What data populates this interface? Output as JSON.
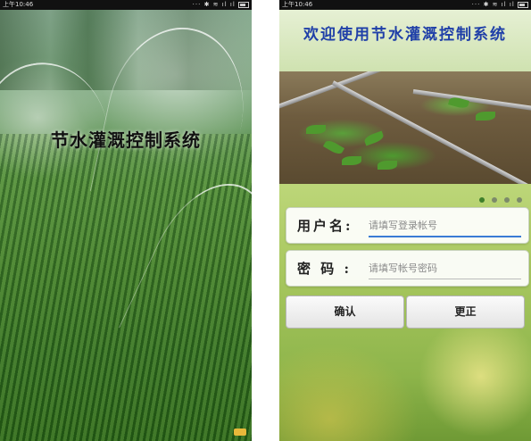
{
  "splash": {
    "status_time": "上午10:46",
    "status_icons": "··· ✱ ≋ ıl ıl",
    "title": "节水灌溉控制系统"
  },
  "login": {
    "status_time": "上午10:46",
    "status_icons": "··· ✱ ≋ ıl ıl",
    "header_title": "欢迎使用节水灌溉控制系统",
    "username_label": "用户名:",
    "username_placeholder": "请填写登录帐号",
    "password_label": "密 码 :",
    "password_placeholder": "请填写帐号密码",
    "confirm_label": "确认",
    "correct_label": "更正",
    "carousel": {
      "count": 4,
      "active_index": 0
    }
  }
}
